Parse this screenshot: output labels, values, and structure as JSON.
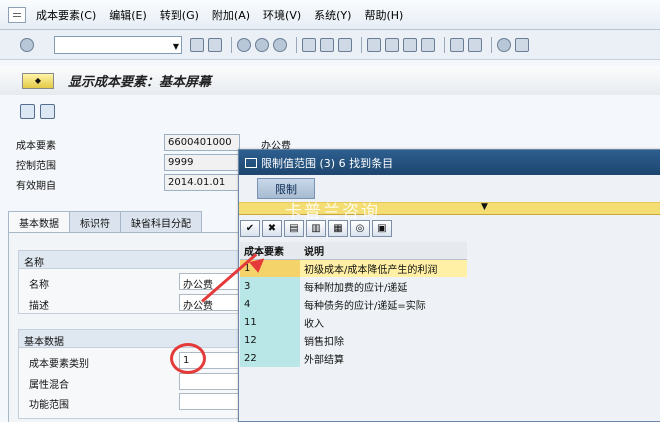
{
  "menu": {
    "items": [
      "成本要素(C)",
      "编辑(E)",
      "转到(G)",
      "附加(A)",
      "环境(V)",
      "系统(Y)",
      "帮助(H)"
    ]
  },
  "screen": {
    "title": "显示成本要素：基本屏幕"
  },
  "header": {
    "cost_element_label": "成本要素",
    "cost_element_value": "6600401000",
    "cost_element_text": "办公费",
    "controlling_area_label": "控制范围",
    "controlling_area_value": "9999",
    "valid_from_label": "有效期自",
    "valid_from_value": "2014.01.01"
  },
  "tabs": [
    "基本数据",
    "标识符",
    "缺省科目分配"
  ],
  "name_group": {
    "title": "名称",
    "name_label": "名称",
    "name_value": "办公费",
    "desc_label": "描述",
    "desc_value": "办公费"
  },
  "basic_group": {
    "title": "基本数据",
    "category_label": "成本要素类别",
    "category_value": "1",
    "attr_label": "属性混合",
    "function_label": "功能范围"
  },
  "popup": {
    "title": "限制值范围 (3)   6 找到条目",
    "tab_label": "限制",
    "watermark": "卡普兰咨询",
    "columns": [
      "成本要素",
      "说明"
    ],
    "rows": [
      {
        "code": "1",
        "desc": "初级成本/成本降低产生的利润"
      },
      {
        "code": "3",
        "desc": "每种附加费的应计/递延"
      },
      {
        "code": "4",
        "desc": "每种债务的应计/递延=实际"
      },
      {
        "code": "11",
        "desc": "收入"
      },
      {
        "code": "12",
        "desc": "销售扣除"
      },
      {
        "code": "22",
        "desc": "外部结算"
      }
    ]
  }
}
